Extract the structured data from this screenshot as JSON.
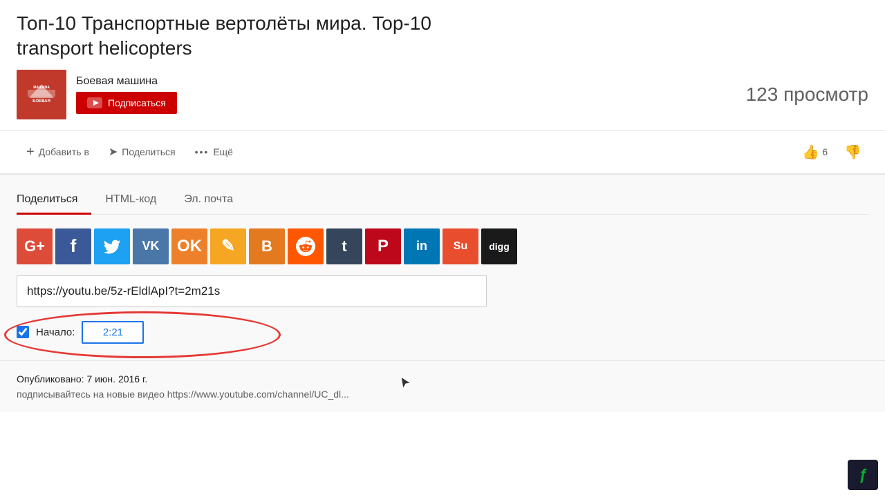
{
  "page": {
    "title_line1": "Топ-10 Транспортные вертолёты мира. Top-10",
    "title_line2": "transport helicopters",
    "channel_name": "Боевая машина",
    "subscribe_label": "Подписаться",
    "views_label": "123 просмотр",
    "action_add": "Добавить в",
    "action_share": "Поделиться",
    "action_more": "Ещё",
    "like_count": "6",
    "tabs": {
      "share": "Поделиться",
      "html": "HTML-код",
      "email": "Эл. почта"
    },
    "social_icons": [
      {
        "name": "google-plus",
        "label": "G+",
        "class": "si-gplus"
      },
      {
        "name": "facebook",
        "label": "f",
        "class": "si-fb"
      },
      {
        "name": "twitter",
        "label": "𝕥",
        "class": "si-tw"
      },
      {
        "name": "vk",
        "label": "вк",
        "class": "si-vk"
      },
      {
        "name": "odnoklassniki",
        "label": "ок",
        "class": "si-ok"
      },
      {
        "name": "pencil",
        "label": "✏",
        "class": "si-pencil"
      },
      {
        "name": "blogger",
        "label": "B",
        "class": "si-blogger"
      },
      {
        "name": "reddit",
        "label": "👽",
        "class": "si-reddit"
      },
      {
        "name": "tumblr",
        "label": "t",
        "class": "si-tumblr"
      },
      {
        "name": "pinterest",
        "label": "P",
        "class": "si-pinterest"
      },
      {
        "name": "linkedin",
        "label": "in",
        "class": "si-linkedin"
      },
      {
        "name": "stumbleupon",
        "label": "Su",
        "class": "si-stumble"
      },
      {
        "name": "digg",
        "label": "digg",
        "class": "si-digg"
      }
    ],
    "url_value": "https://youtu.be/5z-rEldlApI?t=2m21s",
    "start_time_label": "Начало:",
    "start_time_value": "2:21",
    "published_label": "Опубликовано: 7 июн. 2016 г.",
    "subscribe_channel_text": "подписывайтесь на новые видео https://www.youtube.com/channel/UC_dl..."
  }
}
